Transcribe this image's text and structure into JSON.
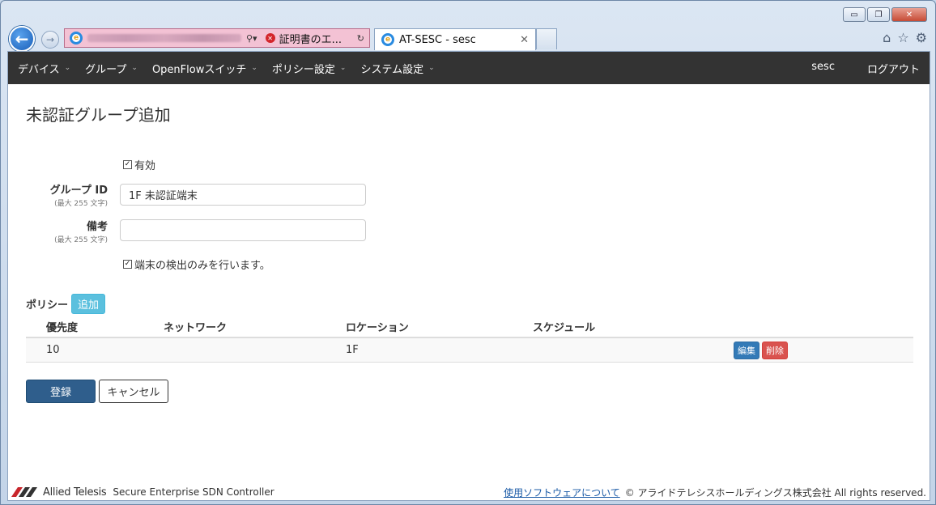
{
  "browser": {
    "cert_error_label": "証明書のエ...",
    "tab_title": "AT-SESC - sesc",
    "win_minimize": "▭",
    "win_restore": "❐",
    "win_close": "✕"
  },
  "navbar": {
    "menu": [
      {
        "label": "デバイス"
      },
      {
        "label": "グループ"
      },
      {
        "label": "OpenFlowスイッチ"
      },
      {
        "label": "ポリシー設定"
      },
      {
        "label": "システム設定"
      }
    ],
    "user": "sesc",
    "logout": "ログアウト"
  },
  "page": {
    "title": "未認証グループ追加"
  },
  "form": {
    "enabled_label": "有効",
    "enabled_checked": true,
    "group_id_label": "グループ ID",
    "group_id_hint": "(最大 255 文字)",
    "group_id_value": "1F 未認証端末",
    "note_label": "備考",
    "note_hint": "(最大 255 文字)",
    "note_value": "",
    "detect_only_label": "端末の検出のみを行います。",
    "detect_only_checked": true
  },
  "policy": {
    "heading": "ポリシー",
    "add_label": "追加",
    "columns": [
      "優先度",
      "ネットワーク",
      "ロケーション",
      "スケジュール"
    ],
    "rows": [
      {
        "priority": "10",
        "network": "",
        "location": "1F",
        "schedule": "",
        "edit_label": "編集",
        "delete_label": "削除"
      }
    ]
  },
  "actions": {
    "submit_label": "登録",
    "cancel_label": "キャンセル"
  },
  "footer": {
    "brand": "Allied Telesis",
    "product": "Secure Enterprise SDN Controller",
    "software_link": "使用ソフトウェアについて",
    "copyright": "© アライドテレシスホールディングス株式会社 All rights reserved."
  }
}
